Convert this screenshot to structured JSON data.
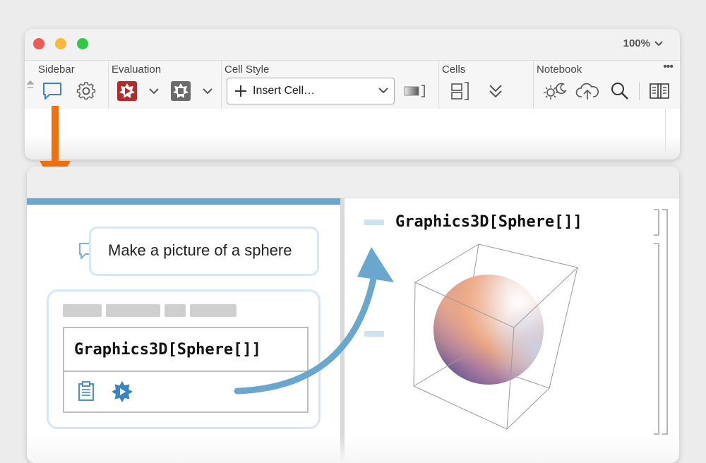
{
  "window": {
    "zoom_label": "100%"
  },
  "toolbar": {
    "groups": {
      "sidebar": "Sidebar",
      "evaluation": "Evaluation",
      "cell_style": "Cell Style",
      "cells": "Cells",
      "notebook": "Notebook"
    },
    "cell_style_value": "Insert Cell…",
    "more_label": "•••"
  },
  "sidebar_panel": {
    "prompt": "Make a picture of a sphere",
    "code": "Graphics3D[Sphere[]]"
  },
  "notebook": {
    "input_code": "Graphics3D[Sphere[]]"
  },
  "colors": {
    "accent_blue": "#6aa7ce",
    "arrow_orange": "#f07010",
    "eval_red": "#b52b2b",
    "icon_blue": "#3a84c6"
  }
}
